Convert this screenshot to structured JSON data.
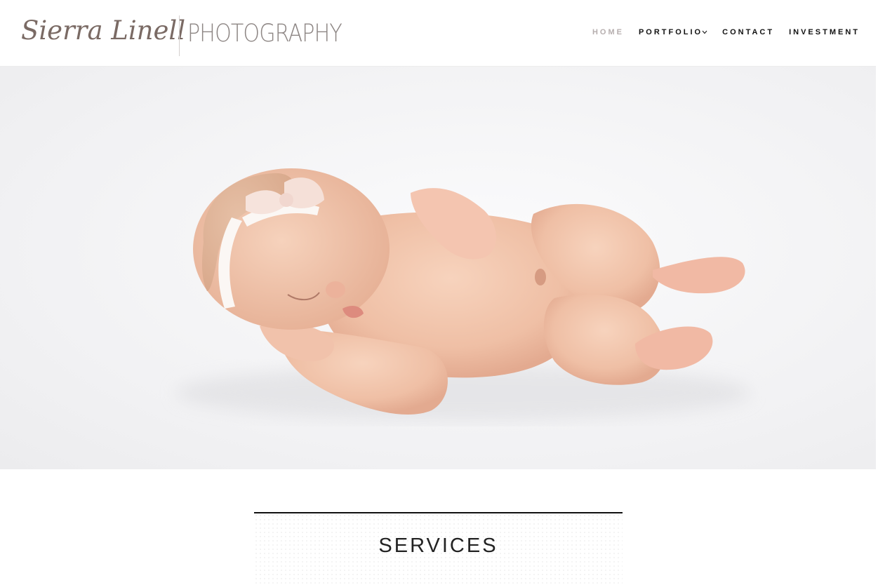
{
  "brand": {
    "script_name": "Sierra Linell",
    "wordmark": "PHOTOGRAPHY"
  },
  "nav": {
    "items": [
      {
        "label": "HOME",
        "active": true
      },
      {
        "label": "PORTFOLIO",
        "has_dropdown": true
      },
      {
        "label": "CONTACT"
      },
      {
        "label": "INVESTMENT"
      }
    ]
  },
  "hero": {
    "image_subject": "sleeping newborn with bow headband"
  },
  "services": {
    "title": "SERVICES"
  },
  "colors": {
    "nav_active": "#b6aeae",
    "nav_text": "#111111",
    "logo": "#8d8684"
  }
}
